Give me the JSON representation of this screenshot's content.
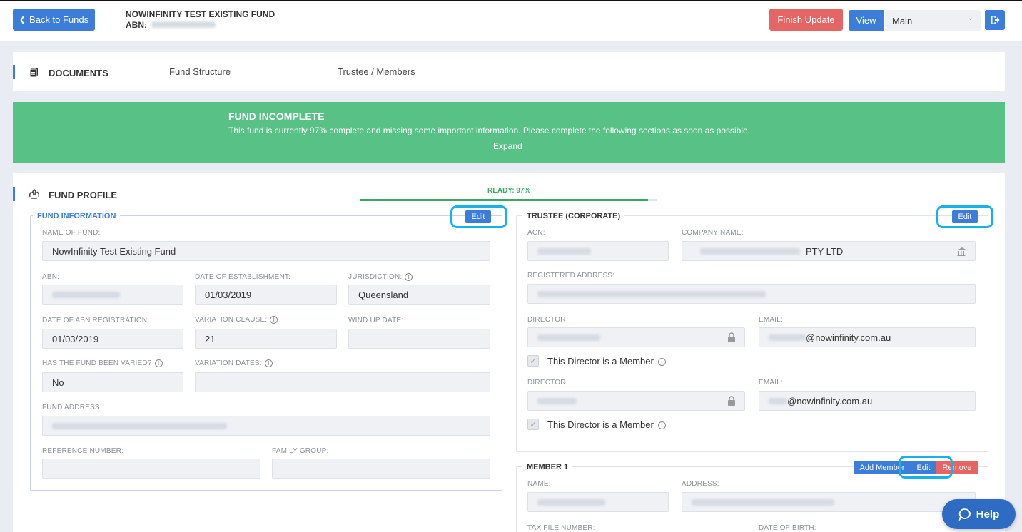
{
  "header": {
    "back_label": "Back to Funds",
    "fund_title": "NOWINFINITY TEST EXISTING FUND",
    "abn_label": "ABN:",
    "finish_label": "Finish Update",
    "view_label": "View",
    "view_select": "Main"
  },
  "nav": {
    "documents_label": "DOCUMENTS",
    "tabs": [
      {
        "label": "Fund Structure"
      },
      {
        "label": "Trustee / Members"
      }
    ]
  },
  "banner": {
    "title": "FUND INCOMPLETE",
    "message": "This fund is currently 97% complete and missing some important information. Please complete the following sections as soon as possible.",
    "expand_label": "Expand"
  },
  "profile": {
    "title": "FUND PROFILE",
    "ready_label": "READY: 97%",
    "ready_fraction": 0.97
  },
  "fund_info": {
    "title": "FUND INFORMATION",
    "edit_label": "Edit",
    "name_label": "NAME OF FUND:",
    "name_value": "NowInfinity Test Existing Fund",
    "abn_label": "ABN:",
    "est_label": "DATE OF ESTABLISHMENT:",
    "est_value": "01/03/2019",
    "jur_label": "JURISDICTION:",
    "jur_value": "Queensland",
    "abn_reg_label": "DATE OF ABN REGISTRATION:",
    "abn_reg_value": "01/03/2019",
    "var_clause_label": "VARIATION CLAUSE:",
    "var_clause_value": "21",
    "wind_label": "WIND UP DATE:",
    "varied_label": "HAS THE FUND BEEN VARIED?",
    "varied_value": "No",
    "var_dates_label": "VARIATION DATES:",
    "address_label": "FUND ADDRESS:",
    "ref_label": "REFERENCE NUMBER:",
    "family_label": "FAMILY GROUP:"
  },
  "trustee": {
    "title": "TRUSTEE (CORPORATE)",
    "edit_label": "Edit",
    "acn_label": "ACN:",
    "company_label": "COMPANY NAME:",
    "company_suffix": "PTY LTD",
    "reg_address_label": "REGISTERED ADDRESS:",
    "directors": [
      {
        "label": "DIRECTOR",
        "email_label": "EMAIL:",
        "email_value": "@nowinfinity.com.au",
        "member_label": "This Director is a Member"
      },
      {
        "label": "DIRECTOR",
        "email_label": "EMAIL:",
        "email_value": "@nowinfinity.com.au",
        "member_label": "This Director is a Member"
      }
    ]
  },
  "member": {
    "title": "MEMBER 1",
    "add_label": "Add Member",
    "edit_label": "Edit",
    "remove_label": "Remove",
    "name_label": "NAME:",
    "address_label": "ADDRESS:",
    "tfn_label": "TAX FILE NUMBER:",
    "dob_label": "DATE OF BIRTH:"
  },
  "help": {
    "label": "Help"
  },
  "colors": {
    "accent": "#3b7dd8",
    "success": "#58c186",
    "danger": "#e56464",
    "highlight": "#16b1e8"
  }
}
